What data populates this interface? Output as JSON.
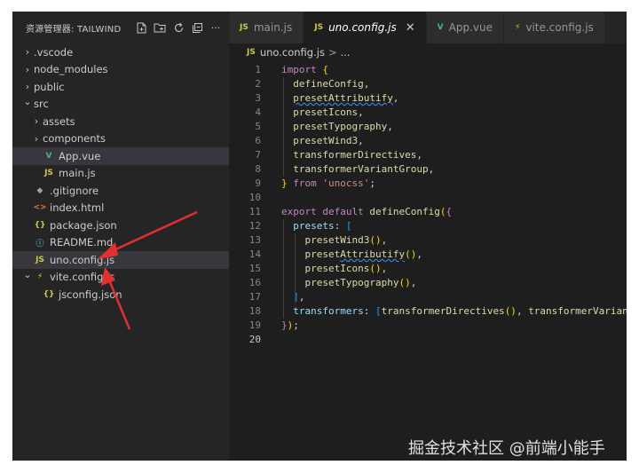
{
  "explorer": {
    "title": "资源管理器: TAILWIND",
    "header_icons": [
      "new-file-icon",
      "new-folder-icon",
      "refresh-icon",
      "collapse-all-icon",
      "more-icon"
    ],
    "more_label": "···",
    "items": [
      {
        "label": ".vscode",
        "type": "folder",
        "expanded": false,
        "depth": 0
      },
      {
        "label": "node_modules",
        "type": "folder",
        "expanded": false,
        "depth": 0
      },
      {
        "label": "public",
        "type": "folder",
        "expanded": false,
        "depth": 0
      },
      {
        "label": "src",
        "type": "folder",
        "expanded": true,
        "depth": 0
      },
      {
        "label": "assets",
        "type": "folder",
        "expanded": false,
        "depth": 1
      },
      {
        "label": "components",
        "type": "folder",
        "expanded": false,
        "depth": 1
      },
      {
        "label": "App.vue",
        "type": "vue",
        "icon_text": "V",
        "depth": 1,
        "active": true
      },
      {
        "label": "main.js",
        "type": "js",
        "icon_text": "JS",
        "depth": 1
      },
      {
        "label": ".gitignore",
        "type": "git",
        "icon_text": "◆",
        "depth": 0
      },
      {
        "label": "index.html",
        "type": "html",
        "icon_text": "<>",
        "depth": 0
      },
      {
        "label": "package.json",
        "type": "json",
        "icon_text": "{}",
        "depth": 0
      },
      {
        "label": "README.md",
        "type": "info",
        "icon_text": "ⓘ",
        "depth": 0
      },
      {
        "label": "uno.config.js",
        "type": "js",
        "icon_text": "JS",
        "depth": 0,
        "selected": true
      },
      {
        "label": "vite.config.js",
        "type": "vite",
        "icon_text": "⚡",
        "depth": 0,
        "expanded": true
      },
      {
        "label": "jsconfig.json",
        "type": "json",
        "icon_text": "{}",
        "depth": 1
      }
    ]
  },
  "tabs": [
    {
      "label": "main.js",
      "icon_text": "JS",
      "icon_color": "#cbcb41",
      "active": false
    },
    {
      "label": "uno.config.js",
      "icon_text": "JS",
      "icon_color": "#cbcb41",
      "active": true,
      "close": "✕"
    },
    {
      "label": "App.vue",
      "icon_text": "V",
      "icon_color": "#41b883",
      "active": false
    },
    {
      "label": "vite.config.js",
      "icon_text": "⚡",
      "icon_color": "#cbcb41",
      "active": false
    }
  ],
  "breadcrumb": {
    "icon_text": "JS",
    "file": "uno.config.js",
    "sep": ">",
    "rest": "..."
  },
  "editor": {
    "current_line": 20,
    "lines": [
      [
        [
          "kw",
          "import"
        ],
        [
          "p",
          " "
        ],
        [
          "br1",
          "{"
        ]
      ],
      [
        [
          "p",
          "  "
        ],
        [
          "fn",
          "defineConfig"
        ],
        [
          "p",
          ","
        ]
      ],
      [
        [
          "p",
          "  "
        ],
        [
          "fn squig",
          "presetAttributify"
        ],
        [
          "p",
          ","
        ]
      ],
      [
        [
          "p",
          "  "
        ],
        [
          "fn",
          "presetIcons"
        ],
        [
          "p",
          ","
        ]
      ],
      [
        [
          "p",
          "  "
        ],
        [
          "fn",
          "presetTypography"
        ],
        [
          "p",
          ","
        ]
      ],
      [
        [
          "p",
          "  "
        ],
        [
          "fn",
          "presetWind3"
        ],
        [
          "p",
          ","
        ]
      ],
      [
        [
          "p",
          "  "
        ],
        [
          "fn",
          "transformerDirectives"
        ],
        [
          "p",
          ","
        ]
      ],
      [
        [
          "p",
          "  "
        ],
        [
          "fn",
          "transformerVariantGroup"
        ],
        [
          "p",
          ","
        ]
      ],
      [
        [
          "br1",
          "}"
        ],
        [
          "p",
          " "
        ],
        [
          "kw",
          "from"
        ],
        [
          "p",
          " "
        ],
        [
          "str",
          "'unocss'"
        ],
        [
          "p",
          ";"
        ]
      ],
      [],
      [
        [
          "kw",
          "export"
        ],
        [
          "p",
          " "
        ],
        [
          "kw",
          "default"
        ],
        [
          "p",
          " "
        ],
        [
          "fn",
          "defineConfig"
        ],
        [
          "br1",
          "("
        ],
        [
          "br2",
          "{"
        ]
      ],
      [
        [
          "p",
          "  "
        ],
        [
          "var",
          "presets"
        ],
        [
          "p",
          ": "
        ],
        [
          "br3",
          "["
        ]
      ],
      [
        [
          "p",
          "    "
        ],
        [
          "fn",
          "presetWind3"
        ],
        [
          "br1",
          "()"
        ],
        [
          "p",
          ","
        ]
      ],
      [
        [
          "p",
          "    "
        ],
        [
          "fn",
          "preset"
        ],
        [
          "fn squig",
          "Attributify"
        ],
        [
          "br1",
          "()"
        ],
        [
          "p",
          ","
        ]
      ],
      [
        [
          "p",
          "    "
        ],
        [
          "fn",
          "presetIcons"
        ],
        [
          "br1",
          "()"
        ],
        [
          "p",
          ","
        ]
      ],
      [
        [
          "p",
          "    "
        ],
        [
          "fn",
          "presetTypography"
        ],
        [
          "br1",
          "()"
        ],
        [
          "p",
          ","
        ]
      ],
      [
        [
          "p",
          "  "
        ],
        [
          "br3",
          "]"
        ],
        [
          "p",
          ","
        ]
      ],
      [
        [
          "p",
          "  "
        ],
        [
          "var",
          "transformers"
        ],
        [
          "p",
          ": "
        ],
        [
          "br3",
          "["
        ],
        [
          "fn",
          "transformerDirectives"
        ],
        [
          "br1",
          "()"
        ],
        [
          "p",
          ", "
        ],
        [
          "fn",
          "transformerVariantGr"
        ]
      ],
      [
        [
          "br2",
          "}"
        ],
        [
          "br1",
          ")"
        ],
        [
          "p",
          ";"
        ]
      ],
      []
    ]
  },
  "watermark": "掘金技术社区 @前端小能手",
  "colors": {
    "editor_bg": "#1e1e1e",
    "sidebar_bg": "#252526",
    "arrow": "#e03030",
    "selection": "#37373d"
  }
}
